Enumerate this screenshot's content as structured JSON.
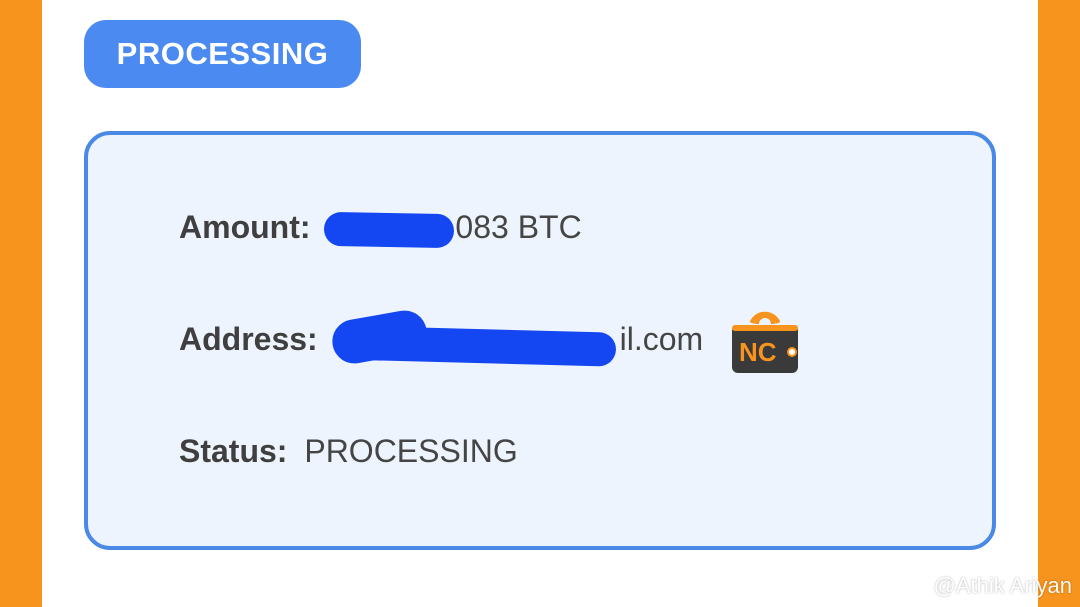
{
  "colors": {
    "background": "#f7941d",
    "card": "#ffffff",
    "accent": "#4a8af1",
    "panel": "#eef4fd",
    "redaction": "#1446f2"
  },
  "header": {
    "status_pill": "PROCESSING"
  },
  "details": {
    "amount": {
      "label": "Amount:",
      "value": "083 BTC"
    },
    "address": {
      "label": "Address:",
      "value": "il.com",
      "badge_icon": "nc-wallet-icon",
      "badge_text": "NC"
    },
    "status": {
      "label": "Status:",
      "value": "PROCESSING"
    }
  },
  "watermark": {
    "icon": "watermark-logo-icon",
    "text": "@Athik Ariyan"
  }
}
